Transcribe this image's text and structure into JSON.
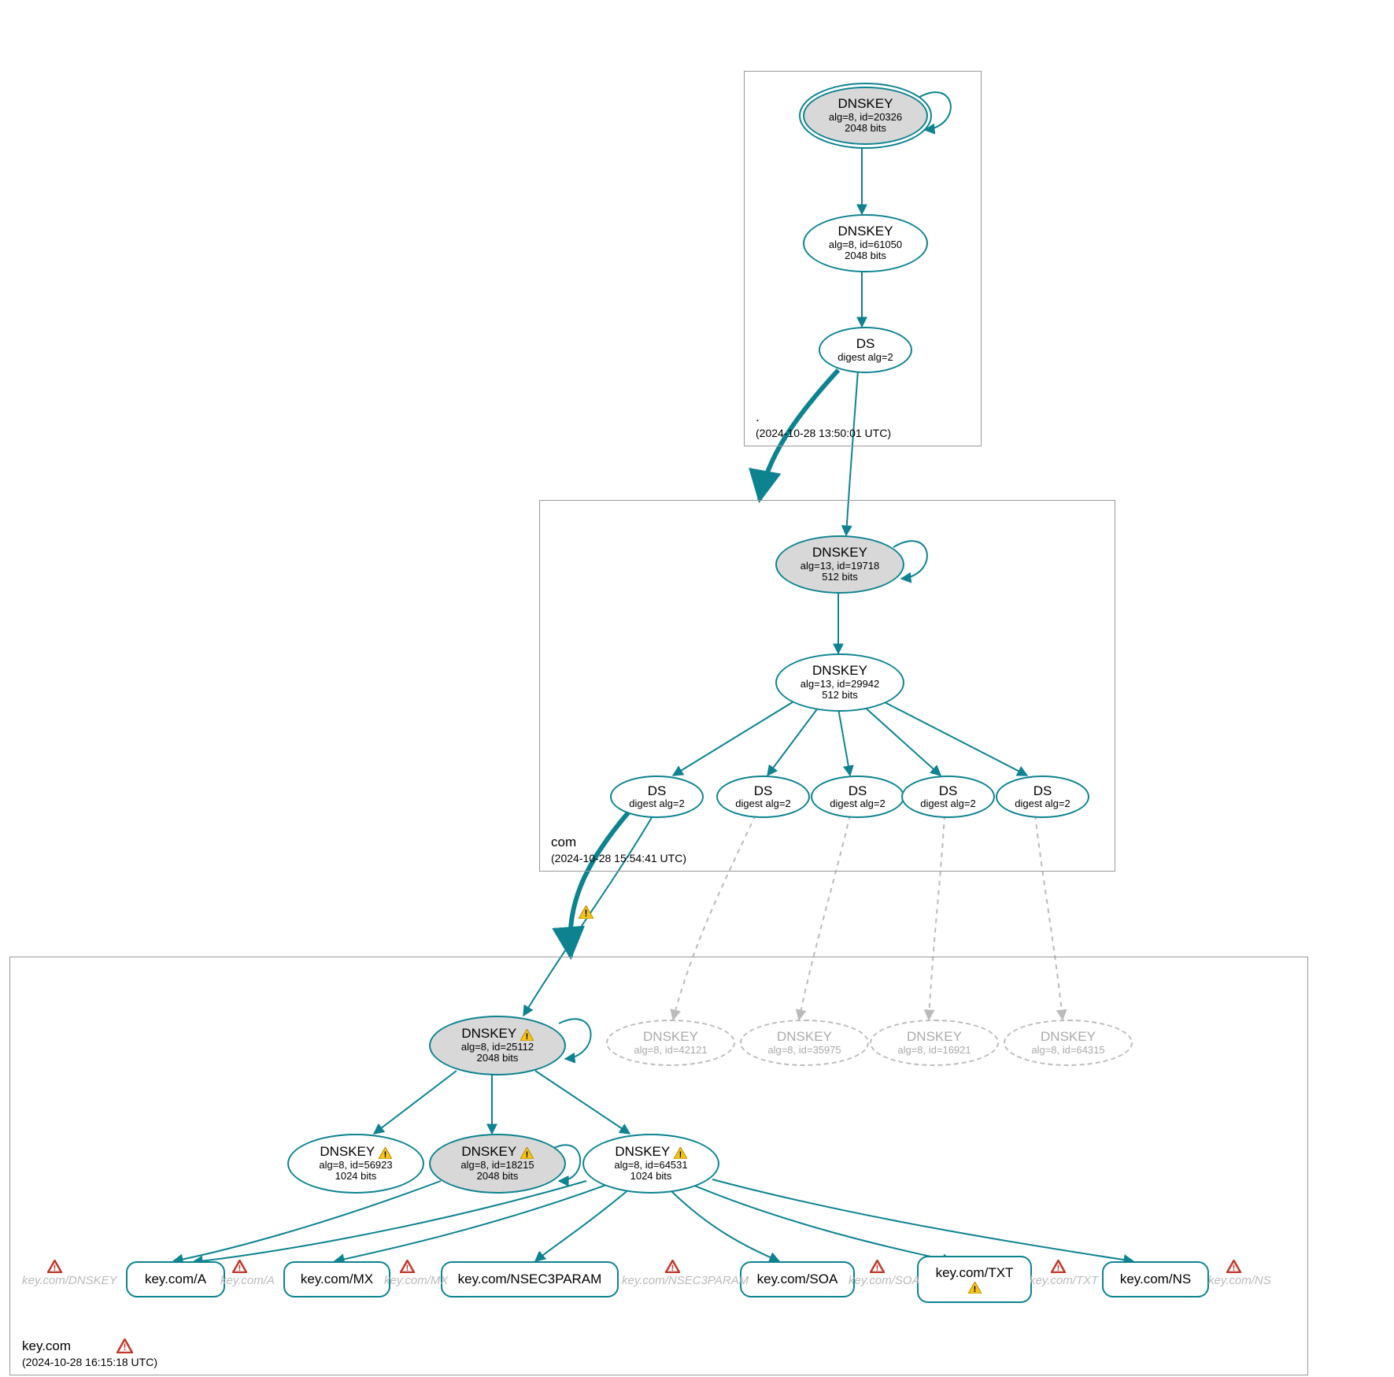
{
  "zones": {
    "root": {
      "name": ".",
      "timestamp": "(2024-10-28 13:50:01 UTC)"
    },
    "com": {
      "name": "com",
      "timestamp": "(2024-10-28 15:54:41 UTC)"
    },
    "key": {
      "name": "key.com",
      "timestamp": "(2024-10-28 16:15:18 UTC)"
    }
  },
  "nodes": {
    "root_ksk": {
      "title": "DNSKEY",
      "line2": "alg=8, id=20326",
      "line3": "2048 bits"
    },
    "root_zsk": {
      "title": "DNSKEY",
      "line2": "alg=8, id=61050",
      "line3": "2048 bits"
    },
    "root_ds": {
      "title": "DS",
      "line2": "digest alg=2"
    },
    "com_ksk": {
      "title": "DNSKEY",
      "line2": "alg=13, id=19718",
      "line3": "512 bits"
    },
    "com_zsk": {
      "title": "DNSKEY",
      "line2": "alg=13, id=29942",
      "line3": "512 bits"
    },
    "com_ds1": {
      "title": "DS",
      "line2": "digest alg=2"
    },
    "com_ds2": {
      "title": "DS",
      "line2": "digest alg=2"
    },
    "com_ds3": {
      "title": "DS",
      "line2": "digest alg=2"
    },
    "com_ds4": {
      "title": "DS",
      "line2": "digest alg=2"
    },
    "com_ds5": {
      "title": "DS",
      "line2": "digest alg=2"
    },
    "key_ksk": {
      "title": "DNSKEY",
      "line2": "alg=8, id=25112",
      "line3": "2048 bits"
    },
    "key_k2": {
      "title": "DNSKEY",
      "line2": "alg=8, id=56923",
      "line3": "1024 bits"
    },
    "key_k3": {
      "title": "DNSKEY",
      "line2": "alg=8, id=18215",
      "line3": "2048 bits"
    },
    "key_k4": {
      "title": "DNSKEY",
      "line2": "alg=8, id=64531",
      "line3": "1024 bits"
    },
    "key_g1": {
      "title": "DNSKEY",
      "line2": "alg=8, id=42121"
    },
    "key_g2": {
      "title": "DNSKEY",
      "line2": "alg=8, id=35975"
    },
    "key_g3": {
      "title": "DNSKEY",
      "line2": "alg=8, id=16921"
    },
    "key_g4": {
      "title": "DNSKEY",
      "line2": "alg=8, id=64315"
    }
  },
  "rr": {
    "a": "key.com/A",
    "mx": "key.com/MX",
    "n3": "key.com/NSEC3PARAM",
    "soa": "key.com/SOA",
    "txt": "key.com/TXT",
    "ns": "key.com/NS"
  },
  "ghosts": {
    "dnskey": "key.com/DNSKEY",
    "a": "key.com/A",
    "mx": "key.com/MX",
    "n3": "key.com/NSEC3PARAM",
    "soa": "key.com/SOA",
    "txt": "key.com/TXT",
    "ns": "key.com/NS"
  }
}
